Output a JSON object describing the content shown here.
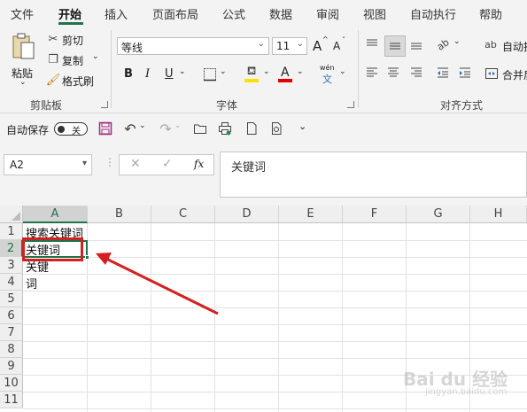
{
  "menu": {
    "tabs": [
      "文件",
      "开始",
      "插入",
      "页面布局",
      "公式",
      "数据",
      "审阅",
      "视图",
      "自动执行",
      "帮助"
    ],
    "active": "开始"
  },
  "clipboard": {
    "paste": "粘贴",
    "cut": "剪切",
    "copy": "复制",
    "format_painter": "格式刷",
    "group_label": "剪贴板"
  },
  "font": {
    "name": "等线",
    "size": "11",
    "grow": "A",
    "shrink": "A",
    "bold": "B",
    "italic": "I",
    "underline": "U",
    "font_color": "A",
    "phonetic_top": "wén",
    "phonetic_bottom": "文",
    "group_label": "字体",
    "highlight_color": "#ffe000",
    "font_color_hex": "#e00000"
  },
  "alignment": {
    "wrap": "自动换",
    "merge": "合并后",
    "group_label": "对齐方式"
  },
  "qat": {
    "autosave": "自动保存",
    "toggle": "关"
  },
  "formula_bar": {
    "name_box": "A2",
    "fx": "fx",
    "content": "关键词"
  },
  "sheet": {
    "columns": [
      "A",
      "B",
      "C",
      "D",
      "E",
      "F",
      "G",
      "H"
    ],
    "rows": [
      "1",
      "2",
      "3",
      "4",
      "5",
      "6",
      "7",
      "8",
      "9",
      "10",
      "11"
    ],
    "cells": {
      "A1": "搜索关键词",
      "A2": "关键词",
      "A3": "关键",
      "A4": "词"
    },
    "selected": "A2"
  },
  "watermark": {
    "text": "Bai du 经验",
    "url": "jingyan.baidu.com"
  }
}
